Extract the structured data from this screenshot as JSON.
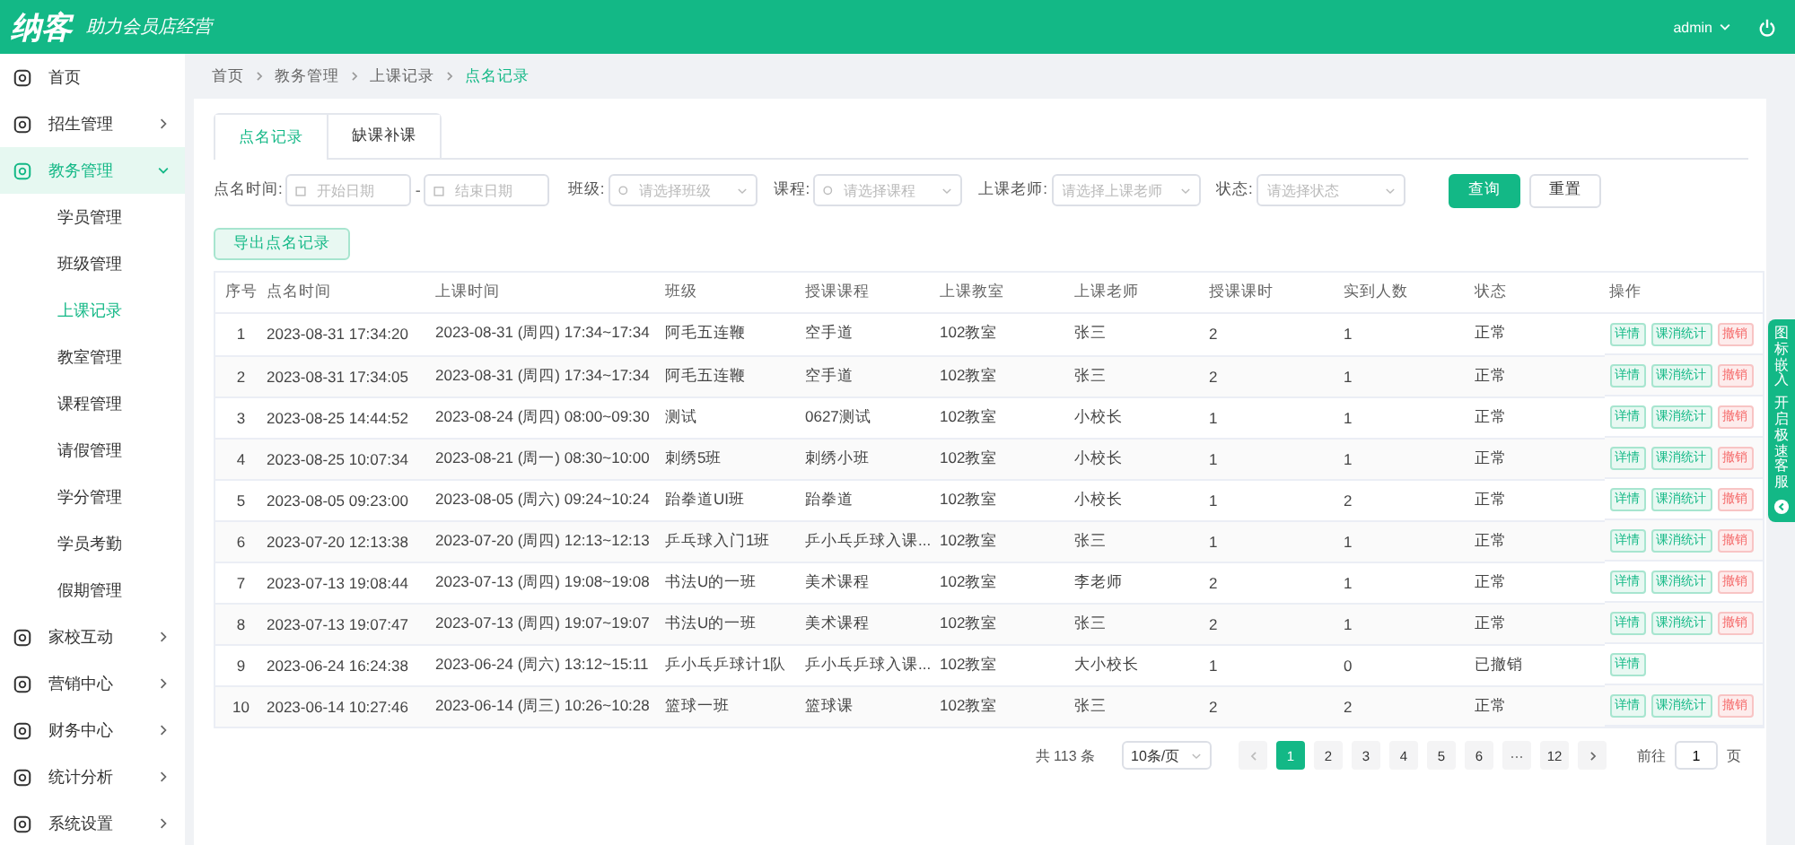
{
  "header": {
    "logo": "纳客",
    "slogan": "助力会员店经营",
    "user": "admin"
  },
  "sidebar": {
    "items": [
      {
        "label": "首页",
        "selected": false
      },
      {
        "label": "招生管理",
        "selected": false,
        "expanded": false
      },
      {
        "label": "教务管理",
        "selected": true,
        "expanded": true,
        "children": [
          {
            "label": "学员管理",
            "selected": false
          },
          {
            "label": "班级管理",
            "selected": false
          },
          {
            "label": "上课记录",
            "selected": true
          },
          {
            "label": "教室管理",
            "selected": false
          },
          {
            "label": "课程管理",
            "selected": false
          },
          {
            "label": "请假管理",
            "selected": false
          },
          {
            "label": "学分管理",
            "selected": false
          },
          {
            "label": "学员考勤",
            "selected": false
          },
          {
            "label": "假期管理",
            "selected": false
          }
        ]
      },
      {
        "label": "家校互动",
        "selected": false,
        "expanded": false
      },
      {
        "label": "营销中心",
        "selected": false,
        "expanded": false
      },
      {
        "label": "财务中心",
        "selected": false,
        "expanded": false
      },
      {
        "label": "统计分析",
        "selected": false,
        "expanded": false
      },
      {
        "label": "系统设置",
        "selected": false,
        "expanded": false
      }
    ]
  },
  "breadcrumb": [
    "首页",
    "教务管理",
    "上课记录",
    "点名记录"
  ],
  "tabs": [
    {
      "label": "点名记录",
      "selected": true
    },
    {
      "label": "缺课补课",
      "selected": false
    }
  ],
  "filters": [
    {
      "kind": "date_range",
      "label": "点名时间:",
      "start_placeholder": "开始日期",
      "separator": "-",
      "end_placeholder": "结束日期"
    },
    {
      "kind": "select",
      "label": "班级:",
      "placeholder": "请选择班级"
    },
    {
      "kind": "select",
      "label": "课程:",
      "placeholder": "请选择课程"
    },
    {
      "kind": "select",
      "label": "上课老师:",
      "placeholder": "请选择上课老师"
    },
    {
      "kind": "select",
      "label": "状态:",
      "placeholder": "请选择状态"
    }
  ],
  "search_button": "查询",
  "reset_button": "重置",
  "export_button": "导出点名记录",
  "table": {
    "columns": [
      "序号",
      "点名时间",
      "上课时间",
      "班级",
      "授课课程",
      "上课教室",
      "上课老师",
      "授课课时",
      "实到人数",
      "状态",
      "操作"
    ],
    "rows": [
      {
        "cells": [
          "1",
          "2023-08-31 17:34:20",
          "2023-08-31 (周四) 17:34~17:34",
          "阿毛五连鞭",
          "空手道",
          "102教室",
          "张三",
          "2",
          "1",
          "正常"
        ],
        "actions": [
          {
            "kind": "detail",
            "label": "详情"
          },
          {
            "kind": "stats",
            "label": "课消统计"
          },
          {
            "kind": "revoke",
            "label": "撤销"
          }
        ]
      },
      {
        "cells": [
          "2",
          "2023-08-31 17:34:05",
          "2023-08-31 (周四) 17:34~17:34",
          "阿毛五连鞭",
          "空手道",
          "102教室",
          "张三",
          "2",
          "1",
          "正常"
        ],
        "actions": [
          {
            "kind": "detail",
            "label": "详情"
          },
          {
            "kind": "stats",
            "label": "课消统计"
          },
          {
            "kind": "revoke",
            "label": "撤销"
          }
        ]
      },
      {
        "cells": [
          "3",
          "2023-08-25 14:44:52",
          "2023-08-24 (周四) 08:00~09:30",
          "测试",
          "0627测试",
          "102教室",
          "小校长",
          "1",
          "1",
          "正常"
        ],
        "actions": [
          {
            "kind": "detail",
            "label": "详情"
          },
          {
            "kind": "stats",
            "label": "课消统计"
          },
          {
            "kind": "revoke",
            "label": "撤销"
          }
        ]
      },
      {
        "cells": [
          "4",
          "2023-08-25 10:07:34",
          "2023-08-21 (周一) 08:30~10:00",
          "刺绣5班",
          "刺绣小班",
          "102教室",
          "小校长",
          "1",
          "1",
          "正常"
        ],
        "actions": [
          {
            "kind": "detail",
            "label": "详情"
          },
          {
            "kind": "stats",
            "label": "课消统计"
          },
          {
            "kind": "revoke",
            "label": "撤销"
          }
        ]
      },
      {
        "cells": [
          "5",
          "2023-08-05 09:23:00",
          "2023-08-05 (周六) 09:24~10:24",
          "跆拳道UI班",
          "跆拳道",
          "102教室",
          "小校长",
          "1",
          "2",
          "正常"
        ],
        "actions": [
          {
            "kind": "detail",
            "label": "详情"
          },
          {
            "kind": "stats",
            "label": "课消统计"
          },
          {
            "kind": "revoke",
            "label": "撤销"
          }
        ]
      },
      {
        "cells": [
          "6",
          "2023-07-20 12:13:38",
          "2023-07-20 (周四) 12:13~12:13",
          "乒乓球入门1班",
          "乒小乓乒球入课...",
          "102教室",
          "张三",
          "1",
          "1",
          "正常"
        ],
        "actions": [
          {
            "kind": "detail",
            "label": "详情"
          },
          {
            "kind": "stats",
            "label": "课消统计"
          },
          {
            "kind": "revoke",
            "label": "撤销"
          }
        ]
      },
      {
        "cells": [
          "7",
          "2023-07-13 19:08:44",
          "2023-07-13 (周四) 19:08~19:08",
          "书法U的一班",
          "美术课程",
          "102教室",
          "李老师",
          "2",
          "1",
          "正常"
        ],
        "actions": [
          {
            "kind": "detail",
            "label": "详情"
          },
          {
            "kind": "stats",
            "label": "课消统计"
          },
          {
            "kind": "revoke",
            "label": "撤销"
          }
        ]
      },
      {
        "cells": [
          "8",
          "2023-07-13 19:07:47",
          "2023-07-13 (周四) 19:07~19:07",
          "书法U的一班",
          "美术课程",
          "102教室",
          "张三",
          "2",
          "1",
          "正常"
        ],
        "actions": [
          {
            "kind": "detail",
            "label": "详情"
          },
          {
            "kind": "stats",
            "label": "课消统计"
          },
          {
            "kind": "revoke",
            "label": "撤销"
          }
        ]
      },
      {
        "cells": [
          "9",
          "2023-06-24 16:24:38",
          "2023-06-24 (周六) 13:12~15:11",
          "乒小乓乒球计1队",
          "乒小乓乒球入课...",
          "102教室",
          "大小校长",
          "1",
          "0",
          "已撤销"
        ],
        "actions": [
          {
            "kind": "detail",
            "label": "详情"
          }
        ]
      },
      {
        "cells": [
          "10",
          "2023-06-14 10:27:46",
          "2023-06-14 (周三) 10:26~10:28",
          "篮球一班",
          "篮球课",
          "102教室",
          "张三",
          "2",
          "2",
          "正常"
        ],
        "actions": [
          {
            "kind": "detail",
            "label": "详情"
          },
          {
            "kind": "stats",
            "label": "课消统计"
          },
          {
            "kind": "revoke",
            "label": "撤销"
          }
        ]
      }
    ]
  },
  "pagination": {
    "total": "共 113 条",
    "page_size": "10条/页",
    "pages": [
      {
        "label": "1",
        "selected": true
      },
      {
        "label": "2",
        "selected": false
      },
      {
        "label": "3",
        "selected": false
      },
      {
        "label": "4",
        "selected": false
      },
      {
        "label": "5",
        "selected": false
      },
      {
        "label": "6",
        "selected": false
      },
      {
        "label": "···",
        "selected": false
      },
      {
        "label": "12",
        "selected": false
      }
    ],
    "goto_label": "前往",
    "goto_value": "1",
    "goto_suffix": "页"
  },
  "side_tab": {
    "lines": [
      "图标嵌入",
      "开启极速客服"
    ]
  }
}
